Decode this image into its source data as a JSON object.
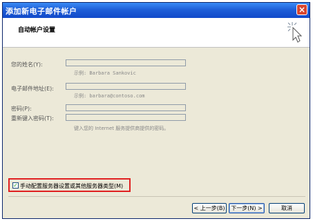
{
  "window": {
    "title": "添加新电子邮件帐户",
    "close_label": "×"
  },
  "header": {
    "heading": "自动帐户设置"
  },
  "form": {
    "name_label": "您的姓名(Y):",
    "name_value": "",
    "name_hint": "示例: Barbara Sankovic",
    "email_label": "电子邮件地址(E):",
    "email_value": "",
    "email_hint": "示例: barbara@contoso.com",
    "password_label": "密码(P):",
    "password_value": "",
    "retype_label": "重新键入密码(T):",
    "retype_value": "",
    "password_hint": "键入您的 Internet 服务提供商提供的密码。"
  },
  "manual": {
    "label": "手动配置服务器设置或其他服务器类型(M)",
    "checked": true
  },
  "buttons": {
    "back": "< 上一步(B)",
    "next": "下一步(N) >",
    "cancel": "取消"
  }
}
